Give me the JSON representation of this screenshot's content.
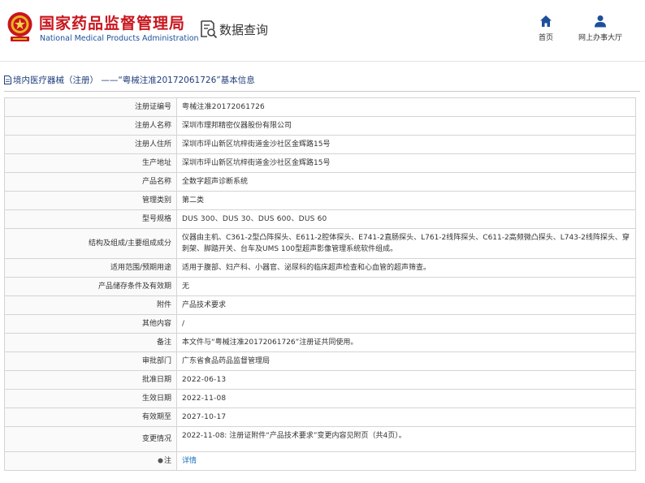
{
  "header": {
    "org_name_cn": "国家药品监督管理局",
    "org_name_en": "National Medical Products Administration",
    "section_title": "数据查询",
    "nav": [
      {
        "label": "首页",
        "icon": "home-icon"
      },
      {
        "label": "网上办事大厅",
        "icon": "user-icon"
      }
    ]
  },
  "breadcrumb": "境内医疗器械（注册） ——“粤械注准20172061726”基本信息",
  "rows": [
    {
      "label": "注册证编号",
      "value": "粤械注准20172061726"
    },
    {
      "label": "注册人名称",
      "value": "深圳市理邦精密仪器股份有限公司"
    },
    {
      "label": "注册人住所",
      "value": "深圳市坪山新区坑梓街道金沙社区金辉路15号"
    },
    {
      "label": "生产地址",
      "value": "深圳市坪山新区坑梓街道金沙社区金辉路15号"
    },
    {
      "label": "产品名称",
      "value": "全数字超声诊断系统"
    },
    {
      "label": "管理类别",
      "value": "第二类"
    },
    {
      "label": "型号规格",
      "value": "DUS 300、DUS 30、DUS 600、DUS 60"
    },
    {
      "label": "结构及组成/主要组成成分",
      "value": "仪器由主机、C361-2型凸阵探头、E611-2腔体探头、E741-2直肠探头、L761-2线阵探头、C611-2高频微凸探头、L743-2线阵探头、穿刺架、脚踏开关、台车及UMS 100型超声影像管理系统软件组成。"
    },
    {
      "label": "适用范围/预期用途",
      "value": "适用于腹部、妇产科、小器官、泌尿科的临床超声检查和心血管的超声筛查。"
    },
    {
      "label": "产品储存条件及有效期",
      "value": "无"
    },
    {
      "label": "附件",
      "value": "产品技术要求"
    },
    {
      "label": "其他内容",
      "value": "/"
    },
    {
      "label": "备注",
      "value": "本文件与“粤械注准20172061726”注册证共同使用。"
    },
    {
      "label": "审批部门",
      "value": "广东省食品药品监督管理局"
    },
    {
      "label": "批准日期",
      "value": "2022-06-13"
    },
    {
      "label": "生效日期",
      "value": "2022-11-08"
    },
    {
      "label": "有效期至",
      "value": "2027-10-17"
    },
    {
      "label": "变更情况",
      "value": "2022-11-08: 注册证附件“产品技术要求”变更内容见附页（共4页）。"
    }
  ],
  "note": {
    "label": "注",
    "link_text": "详情",
    "icon": "pin-icon"
  },
  "colors": {
    "brand_red": "#c8161d",
    "brand_blue": "#1d4f9a",
    "link": "#1a6fc1"
  }
}
